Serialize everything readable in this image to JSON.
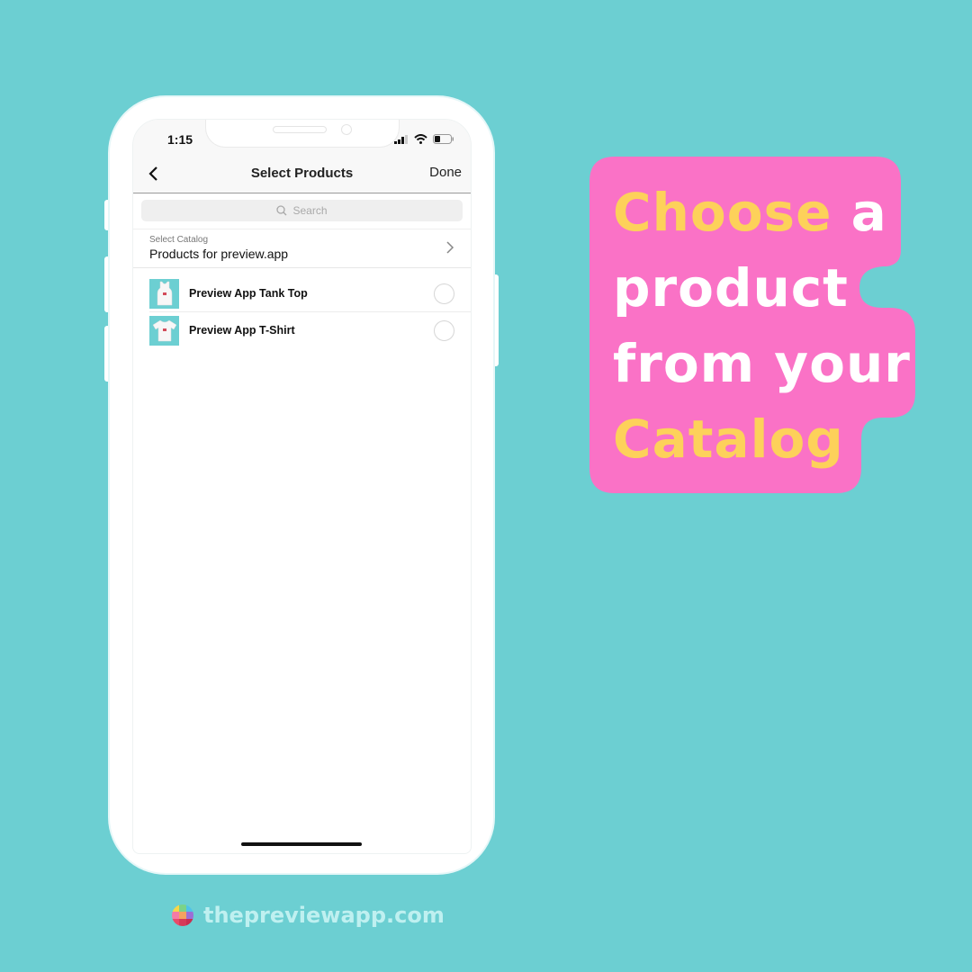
{
  "status_bar": {
    "time": "1:15",
    "icons": [
      "signal-icon",
      "wifi-icon",
      "battery-icon"
    ]
  },
  "nav": {
    "title": "Select Products",
    "back_icon": "chevron-left-icon",
    "done_label": "Done"
  },
  "search": {
    "placeholder": "Search",
    "icon": "search-icon"
  },
  "catalog": {
    "label": "Select Catalog",
    "value": "Products for preview.app",
    "icon": "chevron-right-icon"
  },
  "products": [
    {
      "name": "Preview App Tank Top",
      "thumb_icon": "tank-top-icon",
      "selected": false
    },
    {
      "name": "Preview App T-Shirt",
      "thumb_icon": "t-shirt-icon",
      "selected": false
    }
  ],
  "callout": {
    "line1_highlight": "Choose",
    "line1_rest": " a",
    "line2": "product",
    "line3": "from your",
    "line4_highlight": "Catalog"
  },
  "brand": {
    "text": "thepreviewapp.com",
    "icon": "preview-app-logo-icon"
  },
  "colors": {
    "background": "#6ccfd2",
    "callout_bg": "#fa72c6",
    "highlight": "#fdd15a",
    "brand_text": "#bff0f0"
  }
}
